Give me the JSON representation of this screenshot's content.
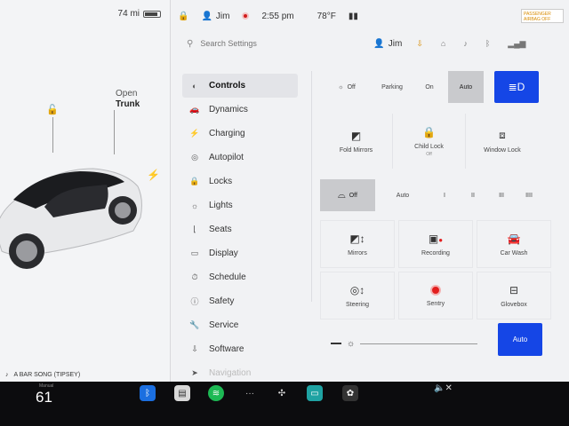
{
  "car_panel": {
    "range": "74 mi",
    "battery_level": 0.75,
    "open_label": "Open",
    "trunk_label": "Trunk",
    "now_playing": "A BAR SONG (TIPSEY)"
  },
  "status_bar": {
    "user": "Jim",
    "time": "2:55 pm",
    "temperature": "78°F",
    "airbag_text": "PASSENGER AIRBAG OFF"
  },
  "search": {
    "placeholder": "Search Settings",
    "user": "Jim"
  },
  "menu": {
    "items": [
      {
        "label": "Controls",
        "icon": "toggle-icon"
      },
      {
        "label": "Dynamics",
        "icon": "car-icon"
      },
      {
        "label": "Charging",
        "icon": "bolt-icon"
      },
      {
        "label": "Autopilot",
        "icon": "steering-wheel-icon"
      },
      {
        "label": "Locks",
        "icon": "lock-icon"
      },
      {
        "label": "Lights",
        "icon": "bulb-icon"
      },
      {
        "label": "Seats",
        "icon": "seat-icon"
      },
      {
        "label": "Display",
        "icon": "display-icon"
      },
      {
        "label": "Schedule",
        "icon": "clock-icon"
      },
      {
        "label": "Safety",
        "icon": "info-icon"
      },
      {
        "label": "Service",
        "icon": "wrench-icon"
      },
      {
        "label": "Software",
        "icon": "download-icon"
      },
      {
        "label": "Navigation",
        "icon": "navigation-icon"
      }
    ]
  },
  "controls": {
    "headlights": [
      "Off",
      "Parking",
      "On",
      "Auto"
    ],
    "headlights_selected": "Auto",
    "tiles": [
      {
        "label": "Fold Mirrors",
        "sub": ""
      },
      {
        "label": "Child Lock",
        "sub": "Off"
      },
      {
        "label": "Window Lock",
        "sub": ""
      }
    ],
    "wipers": [
      "Off",
      "Auto",
      "I",
      "II",
      "III",
      "IIII"
    ],
    "wipers_selected": "Off",
    "grid": [
      {
        "label": "Mirrors",
        "icon": "mirror-adjust-icon"
      },
      {
        "label": "Recording",
        "icon": "dashcam-icon"
      },
      {
        "label": "Car Wash",
        "icon": "car-wash-icon"
      },
      {
        "label": "Steering",
        "icon": "steering-adjust-icon"
      },
      {
        "label": "Sentry",
        "icon": "sentry-icon"
      },
      {
        "label": "Glovebox",
        "icon": "glovebox-icon"
      }
    ],
    "brightness_auto": "Auto"
  },
  "dock": {
    "temp_label": "Manual",
    "temp": "61"
  },
  "colors": {
    "accent_blue": "#1546e6",
    "sentry_red": "#e21d1d",
    "panel_bg": "#f1f2f4"
  }
}
